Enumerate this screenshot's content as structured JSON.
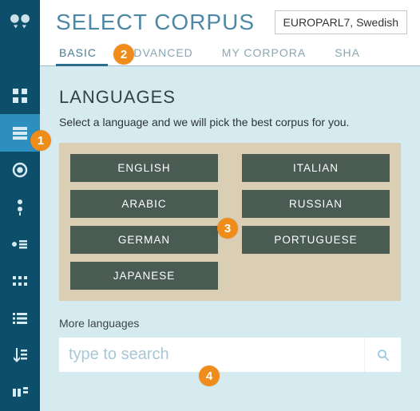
{
  "page": {
    "title": "SELECT CORPUS",
    "selected_corpus": "EUROPARL7, Swedish"
  },
  "tabs": {
    "basic": "BASIC",
    "advanced": "ADVANCED",
    "my": "MY CORPORA",
    "shared": "SHA"
  },
  "section": {
    "heading": "LANGUAGES",
    "desc": "Select a language and we will pick the best corpus for you."
  },
  "languages": {
    "english": "ENGLISH",
    "italian": "ITALIAN",
    "arabic": "ARABIC",
    "russian": "RUSSIAN",
    "german": "GERMAN",
    "portuguese": "PORTUGUESE",
    "japanese": "JAPANESE"
  },
  "more": {
    "label": "More languages",
    "placeholder": "type to search"
  },
  "callouts": {
    "c1": "1",
    "c2": "2",
    "c3": "3",
    "c4": "4"
  }
}
